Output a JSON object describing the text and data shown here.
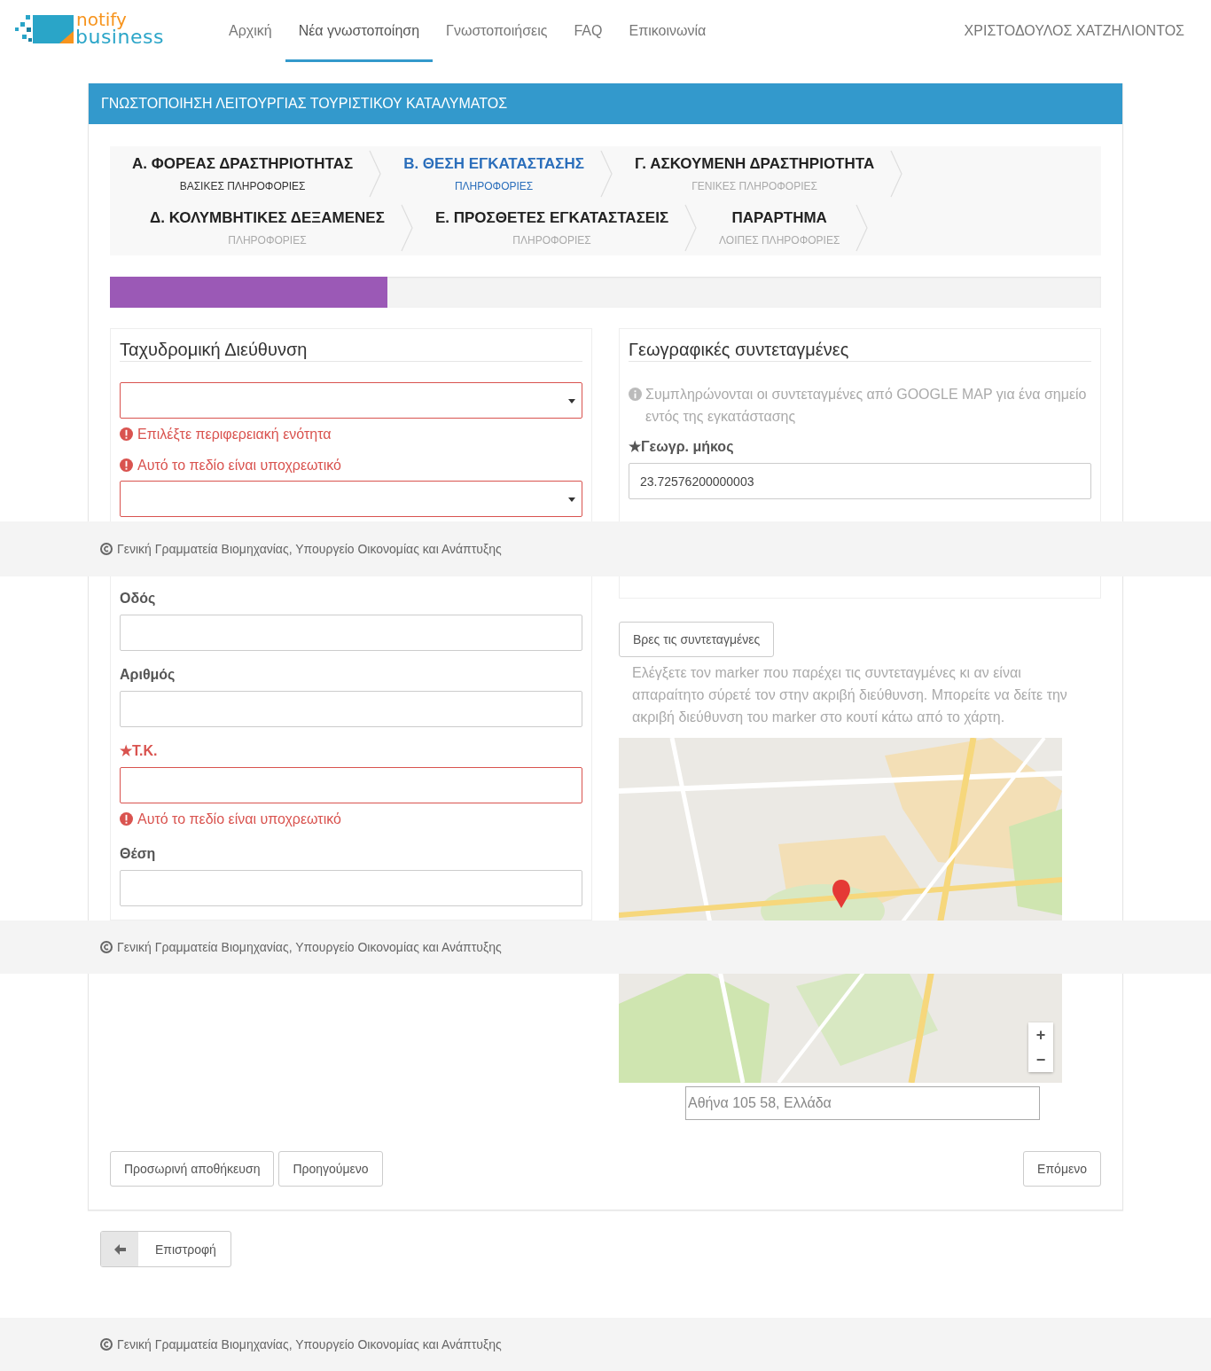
{
  "header": {
    "logo": {
      "word_1": "notify",
      "word_2": "business"
    },
    "nav": [
      {
        "label": "Αρχική",
        "selected": false
      },
      {
        "label": "Νέα γνωστοποίηση",
        "selected": true
      },
      {
        "label": "Γνωστοποιήσεις",
        "selected": false
      },
      {
        "label": "FAQ",
        "selected": false
      },
      {
        "label": "Επικοινωνία",
        "selected": false
      }
    ],
    "user": "ΧΡΙΣΤΟΔΟΥΛΟΣ ΧΑΤΖΗΛΙΟΝΤΟΣ"
  },
  "panel": {
    "title": "ΓΝΩΣΤΟΠΟΙΗΣΗ ΛΕΙΤΟΥΡΓΙΑΣ ΤΟΥΡΙΣΤΙΚΟΥ ΚΑΤΑΛΥΜΑΤΟΣ",
    "steps": [
      {
        "title": "Α. ΦΟΡΕΑΣ ΔΡΑΣΤΗΡΙΟΤΗΤΑΣ",
        "subtitle": "ΒΑΣΙΚΕΣ ΠΛΗΡΟΦΟΡΙΕΣ",
        "selected": false,
        "completed": true
      },
      {
        "title": "Β. ΘΕΣΗ ΕΓΚΑΤΑΣΤΑΣΗΣ",
        "subtitle": "ΠΛΗΡΟΦΟΡΙΕΣ",
        "selected": true,
        "completed": false
      },
      {
        "title": "Γ. ΑΣΚΟΥΜΕΝΗ ΔΡΑΣΤΗΡΙΟΤΗΤΑ",
        "subtitle": "ΓΕΝΙΚΕΣ ΠΛΗΡΟΦΟΡΙΕΣ",
        "selected": false,
        "completed": false
      },
      {
        "title": "Δ. ΚΟΛΥΜΒΗΤΙΚΕΣ ΔΕΞΑΜΕΝΕΣ",
        "subtitle": "ΠΛΗΡΟΦΟΡΙΕΣ",
        "selected": false,
        "completed": false
      },
      {
        "title": "Ε. ΠΡΟΣΘΕΤΕΣ ΕΓΚΑΤΑΣΤΑΣΕΙΣ",
        "subtitle": "ΠΛΗΡΟΦΟΡΙΕΣ",
        "selected": false,
        "completed": false
      },
      {
        "title": "ΠΑΡΑΡΤΗΜΑ",
        "subtitle": "ΛΟΙΠΕΣ ΠΛΗΡΟΦΟΡΙΕΣ",
        "selected": false,
        "completed": false
      }
    ],
    "progress": {
      "level": 0.28
    },
    "address": {
      "title": "Ταχυδρομική Διεύθυνση",
      "fields": [
        {
          "kind": "select",
          "invalid": true,
          "errors": [
            "Επιλέξτε περιφερειακή ενότητα",
            "Αυτό το πεδίο είναι υποχρεωτικό"
          ]
        },
        {
          "kind": "select",
          "invalid": true
        },
        {
          "kind": "input",
          "label": "Οδός",
          "invalid": false
        },
        {
          "kind": "input",
          "label": "Αριθμός",
          "invalid": false
        },
        {
          "kind": "input",
          "label": "★Τ.Κ.",
          "invalid": true,
          "errors": [
            "Αυτό το πεδίο είναι υποχρεωτικό"
          ]
        },
        {
          "kind": "input",
          "label": "Θέση",
          "invalid": false
        }
      ]
    },
    "coordinates": {
      "title": "Γεωγραφικές συντεταγμένες",
      "info": "Συμπληρώνονται οι συντεταγμένες από GOOGLE MAP για ένα σημείο εντός της εγκατάστασης",
      "fields": [
        {
          "label": "★Γεωγρ. μήκος",
          "value": "23.72576200000003"
        }
      ],
      "find_button": "Βρες τις συντεταγμένες",
      "help": "Ελέγξετε τον marker που παρέχει τις συντεταγμένες κι αν είναι απαραίτητο σύρετέ τον στην ακριβή διεύθυνση. Μπορείτε να δείτε την ακριβή διεύθυνση του marker στο κουτί κάτω από το χάρτη.",
      "map": {
        "kind": "picture",
        "zoom_in": "+",
        "zoom_out": "−"
      },
      "address_value": "Αθήνα 105 58, Ελλάδα"
    },
    "actions": [
      "Προσωρινή αποθήκευση",
      "Προηγούμενο"
    ],
    "next": "Επόμενο"
  },
  "back": "Επιστροφή",
  "overlays": [
    "Γενική Γραμματεία Βιομηχανίας, Υπουργείο Οικονομίας και Ανάπτυξης",
    "Γενική Γραμματεία Βιομηχανίας, Υπουργείο Οικονομίας και Ανάπτυξης"
  ],
  "footer": "Γενική Γραμματεία Βιομηχανίας, Υπουργείο Οικονομίας και Ανάπτυξης"
}
